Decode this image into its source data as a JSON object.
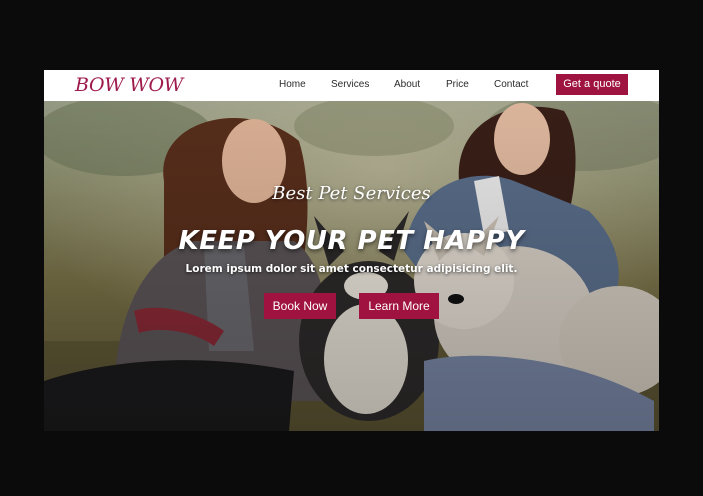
{
  "brand": {
    "logo": "BOW WOW"
  },
  "nav": {
    "links": [
      "Home",
      "Services",
      "About",
      "Price",
      "Contact"
    ],
    "cta_label": "Get a quote"
  },
  "hero": {
    "kicker": "Best Pet Services",
    "title": "KEEP YOUR PET HAPPY",
    "subtitle": "Lorem ipsum dolor sit amet consectetur adipisicing elit.",
    "buttons": {
      "primary": "Book Now",
      "secondary": "Learn More"
    }
  },
  "colors": {
    "brand": "#9e1a4c",
    "button": "#a0123f",
    "page_background": "#0b0b0c"
  }
}
